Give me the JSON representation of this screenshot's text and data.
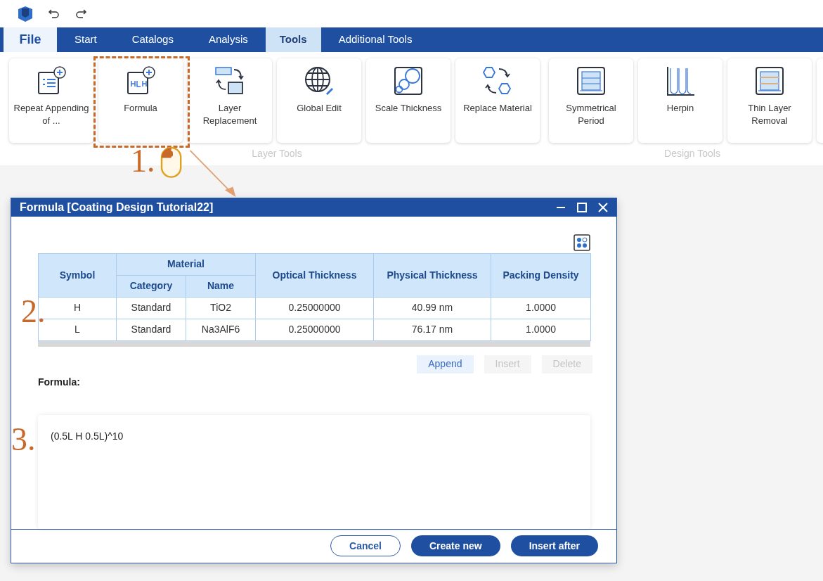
{
  "tabs": [
    {
      "label": "File",
      "kind": "file",
      "selected": false
    },
    {
      "label": "Start",
      "kind": "tab",
      "selected": false
    },
    {
      "label": "Catalogs",
      "kind": "tab",
      "selected": false
    },
    {
      "label": "Analysis",
      "kind": "tab",
      "selected": false
    },
    {
      "label": "Tools",
      "kind": "tab",
      "selected": true
    },
    {
      "label": "Additional Tools",
      "kind": "tab",
      "selected": false
    }
  ],
  "ribbon_groups": [
    {
      "label": "Layer Tools",
      "tools": [
        "Repeat Appending of ...",
        "Formula",
        "Layer Replacement",
        "Global Edit",
        "Scale Thickness",
        "Replace Material"
      ]
    },
    {
      "label": "Design Tools",
      "tools": [
        "Symmetrical Period",
        "Herpin",
        "Thin Layer Removal"
      ]
    }
  ],
  "dialog": {
    "title": "Formula [Coating Design Tutorial22]",
    "table": {
      "columns": [
        {
          "label": "Symbol"
        },
        {
          "label": "Material",
          "colspan": 2,
          "children": [
            {
              "label": "Category"
            },
            {
              "label": "Name"
            }
          ]
        },
        {
          "label": "Optical Thickness"
        },
        {
          "label": "Physical Thickness"
        },
        {
          "label": "Packing Density"
        }
      ],
      "rows": [
        [
          "H",
          "Standard",
          "TiO2",
          "0.25000000",
          "40.99 nm",
          "1.0000"
        ],
        [
          "L",
          "Standard",
          "Na3AlF6",
          "0.25000000",
          "76.17 nm",
          "1.0000"
        ]
      ]
    },
    "table_buttons": [
      {
        "label": "Append",
        "disabled": false
      },
      {
        "label": "Insert",
        "disabled": true
      },
      {
        "label": "Delete",
        "disabled": true
      }
    ],
    "formula_label": "Formula:",
    "formula_value": "(0.5L H 0.5L)^10",
    "buttons": [
      {
        "label": "Cancel",
        "kind": "outline"
      },
      {
        "label": "Create new",
        "kind": "primary"
      },
      {
        "label": "Insert after",
        "kind": "primary"
      }
    ]
  },
  "annotations": [
    {
      "label": "1."
    },
    {
      "label": "2."
    },
    {
      "label": "3."
    }
  ]
}
